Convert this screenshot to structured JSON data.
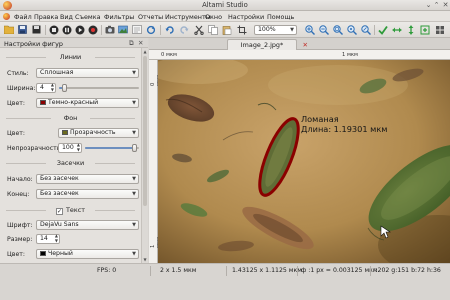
{
  "window": {
    "title": "Altami Studio",
    "minimize_glyph": "⌄",
    "maximize_glyph": "⌃",
    "close_glyph": "✕"
  },
  "menu": [
    "Файл",
    "Правка",
    "Вид",
    "Съемка",
    "Фильтры",
    "Отчеты",
    "Инструменты",
    "Окно",
    "Настройки",
    "Помощь"
  ],
  "toolbar": {
    "zoom": "100%"
  },
  "panel": {
    "title": "Настройки фигур",
    "lines": {
      "heading": "Линии",
      "style_label": "Стиль:",
      "style_value": "Сплошная",
      "width_label": "Ширина:",
      "width_value": "4",
      "color_label": "Цвет:",
      "color_value": "Темно-красный",
      "color_hex": "#8b0000"
    },
    "background": {
      "heading": "Фон",
      "color_label": "Цвет:",
      "color_value": "Прозрачность",
      "color_hex": "#6b6b1e",
      "opacity_label": "Непрозрачность:",
      "opacity_value": "100",
      "opacity_level": 1.0
    },
    "arrows": {
      "heading": "Засечки",
      "start_label": "Начало:",
      "start_value": "Без засечек",
      "end_label": "Конец:",
      "end_value": "Без засечек"
    },
    "text": {
      "heading": "Текст",
      "enabled": true,
      "font_label": "Шрифт:",
      "font_value": "DejaVu Sans",
      "size_label": "Размер:",
      "size_value": "14",
      "color_label": "Цвет:",
      "color_value": "Черный",
      "color_hex": "#000000"
    }
  },
  "document": {
    "tab_title": "Image_2.jpg*"
  },
  "ruler": {
    "unit": "мкм",
    "h_ticks": [
      "0 мкм",
      "1 мкм"
    ],
    "v_ticks": [
      "0 мкм",
      "1 мкм"
    ]
  },
  "annotation": {
    "line1": "Ломаная",
    "line2": "Длина: 1.19301 мкм",
    "outline_color": "#8b0000"
  },
  "status": {
    "fps": "FPS: 0",
    "binning": "2 x 1.5 мкм",
    "size": "1.43125 x 1.1125 мкм",
    "scale": "ф :1 px = 0.003125 мкм",
    "pixel": "r:202 g:151 b:72 h:36"
  }
}
